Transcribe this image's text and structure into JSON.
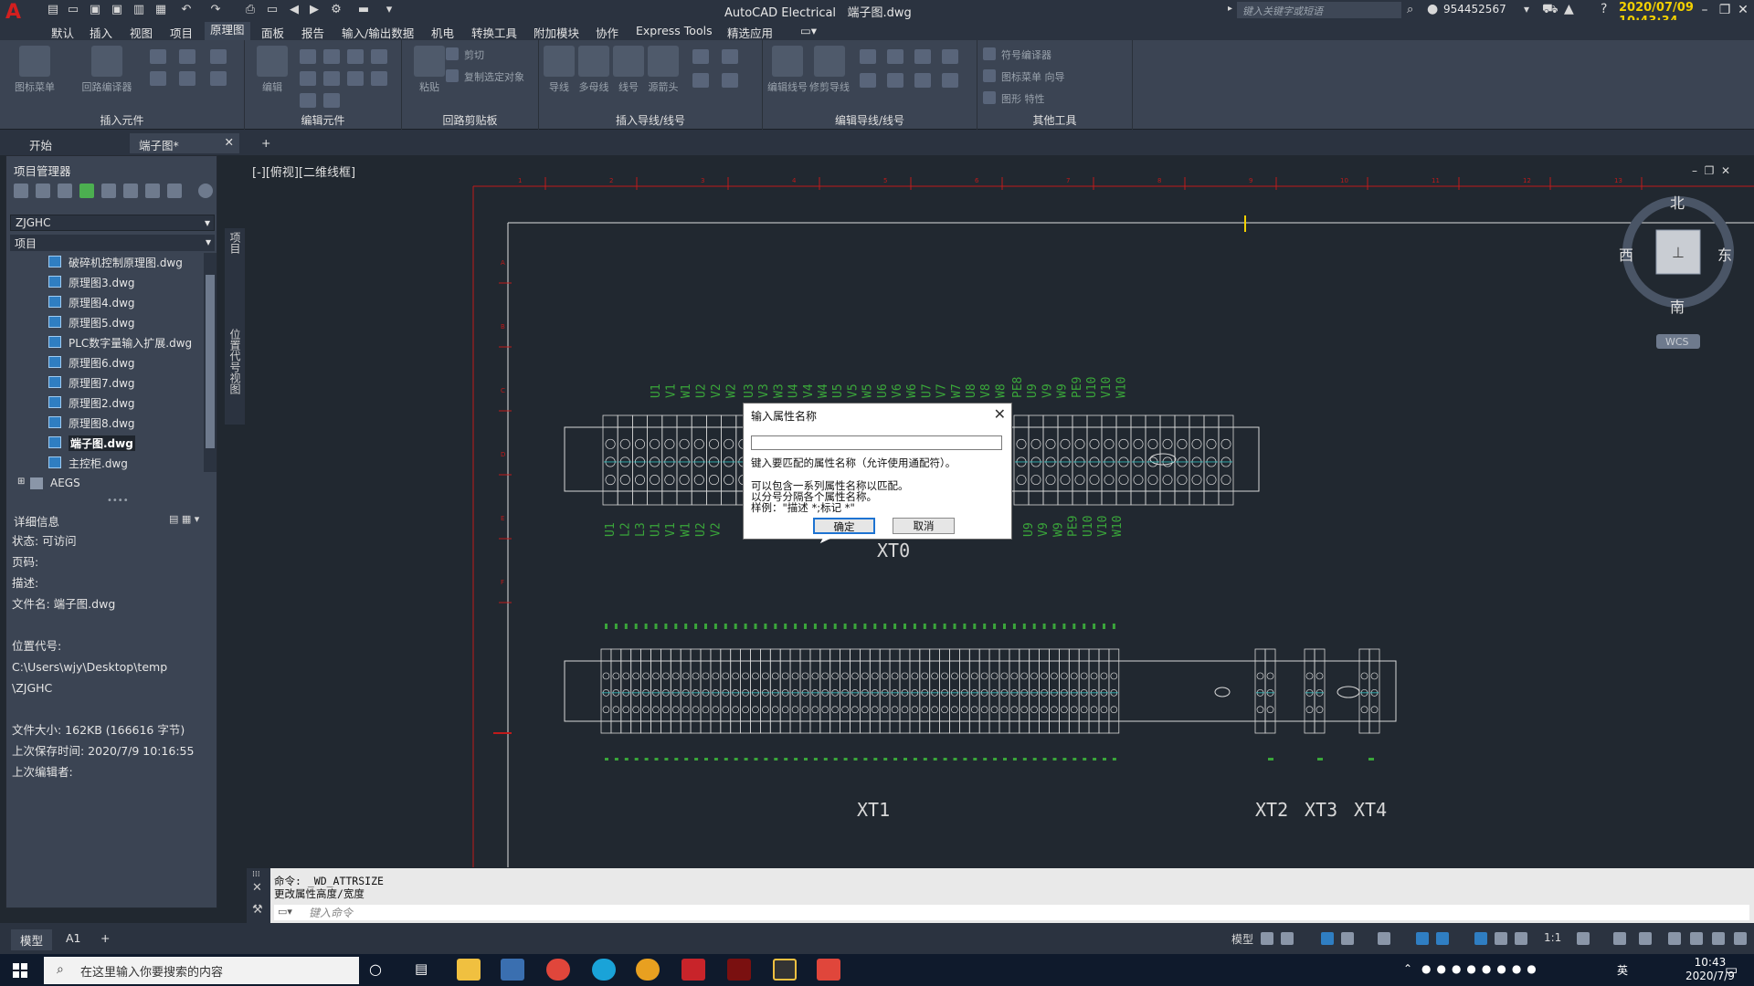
{
  "titlebar": {
    "app_title": "AutoCAD Electrical",
    "document": "端子图.dwg",
    "search_placeholder": "键入关键字或短语",
    "user": "954452567",
    "clock_overlay": "2020/07/09 10:43:34"
  },
  "menu": [
    "默认",
    "插入",
    "视图",
    "项目",
    "原理图",
    "面板",
    "报告",
    "输入/输出数据",
    "机电",
    "转换工具",
    "附加模块",
    "协作",
    "Express Tools",
    "精选应用"
  ],
  "menu_active": "原理图",
  "ribbon": {
    "groups": [
      "插入元件",
      "编辑元件",
      "回路剪贴板",
      "插入导线/线号",
      "编辑导线/线号",
      "其他工具"
    ],
    "buttons": [
      "图标菜单",
      "回路编译器",
      "编辑",
      "粘贴",
      "剪切",
      "复制选定对象",
      "导线",
      "多母线",
      "线号",
      "源箭头",
      "编辑线号",
      "修剪导线",
      "符号编译器",
      "图标菜单 向导",
      "图形 特性"
    ]
  },
  "doc_tabs": {
    "start": "开始",
    "drawing": "端子图*"
  },
  "project_manager": {
    "title": "项目管理器",
    "combo": "ZJGHC",
    "header": "项目",
    "files": [
      "破碎机控制原理图.dwg",
      "原理图3.dwg",
      "原理图4.dwg",
      "原理图5.dwg",
      "PLC数字量输入扩展.dwg",
      "原理图6.dwg",
      "原理图7.dwg",
      "原理图2.dwg",
      "原理图8.dwg",
      "端子图.dwg",
      "主控柜.dwg"
    ],
    "folder": "AEGS",
    "side_tabs": [
      "项目",
      "位置代号视图"
    ]
  },
  "details": {
    "title": "详细信息",
    "status": "状态: 可访问",
    "page": "页码:",
    "desc": "描述:",
    "filename": "文件名: 端子图.dwg",
    "location": "位置代号: C:\\Users\\wjy\\Desktop\\temp",
    "location2": "\\ZJGHC",
    "size": "文件大小: 162KB (166616 字节)",
    "saved": "上次保存时间: 2020/7/9 10:16:55",
    "editor": "上次编辑者:"
  },
  "viewport_label": "[-][俯视][二维线框]",
  "viewcube": {
    "n": "北",
    "s": "南",
    "e": "东",
    "w": "西",
    "wcs": "WCS"
  },
  "drawing": {
    "strips": [
      "XT0",
      "XT1",
      "XT2",
      "XT3",
      "XT4"
    ],
    "top_ruler": [
      "1",
      "2",
      "3",
      "4",
      "5",
      "6",
      "7",
      "8",
      "9",
      "10",
      "11",
      "12",
      "13"
    ],
    "left_ruler": [
      "A",
      "B",
      "C",
      "D",
      "E",
      "F"
    ],
    "xt0_top_left": [
      "U1",
      "V1",
      "W1",
      "U2",
      "V2",
      "W2"
    ],
    "xt0_top_right": [
      "PE8",
      "U9",
      "V9",
      "W9",
      "PE9",
      "U10",
      "V10",
      "W10"
    ],
    "xt0_bot_left": [
      "U1",
      "L2",
      "L3",
      "U1",
      "V1",
      "W1",
      "U2",
      "V2"
    ],
    "xt0_bot_right": [
      "U9",
      "V9",
      "W9",
      "PE9",
      "U10",
      "V10",
      "W10"
    ],
    "xt0_top_mid": [
      "U3",
      "V3",
      "W3",
      "U4",
      "V4",
      "W4",
      "U5",
      "V5",
      "W5",
      "U6",
      "V6",
      "W6",
      "U7",
      "V7",
      "W7",
      "U8",
      "V8",
      "W8"
    ]
  },
  "dialog": {
    "title": "输入属性名称",
    "input_value": "",
    "line1": "键入要匹配的属性名称（允许使用通配符）。",
    "line2": "可以包含一系列属性名称以匹配。",
    "line3": "以分号分隔各个属性名称。",
    "line4": "样例：\"描述 *;标记 *\"",
    "ok": "确定",
    "cancel": "取消"
  },
  "command": {
    "line1": "命令: _WD_ATTRSIZE",
    "line2": "更改属性高度/宽度",
    "prompt": "键入命令"
  },
  "layout_tabs": [
    "模型",
    "A1"
  ],
  "status": {
    "model": "模型",
    "scale": "1:1"
  },
  "taskbar": {
    "search": "在这里输入你要搜索的内容",
    "time": "10:43",
    "date": "2020/7/9",
    "ime": "英"
  }
}
